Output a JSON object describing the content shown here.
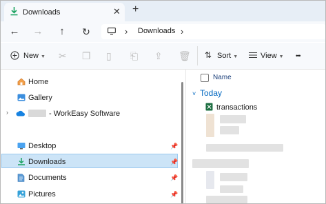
{
  "tab": {
    "title": "Downloads",
    "close": "✕",
    "new": "+"
  },
  "address": {
    "location": "Downloads",
    "sep1": "›",
    "sep2": "›"
  },
  "toolbar": {
    "new_label": "New",
    "sort_label": "Sort",
    "view_label": "View",
    "more": "•••"
  },
  "nav": {
    "home": "Home",
    "gallery": "Gallery",
    "onedrive": "- WorkEasy Software",
    "desktop": "Desktop",
    "downloads": "Downloads",
    "documents": "Documents",
    "pictures": "Pictures"
  },
  "files": {
    "col_name": "Name",
    "group": "Today",
    "first_file": "transactions"
  },
  "colors": {
    "accent": "#0067c0",
    "selection": "#cce4f7",
    "excel": "#1d6f42",
    "folder": "#e8b84b"
  }
}
